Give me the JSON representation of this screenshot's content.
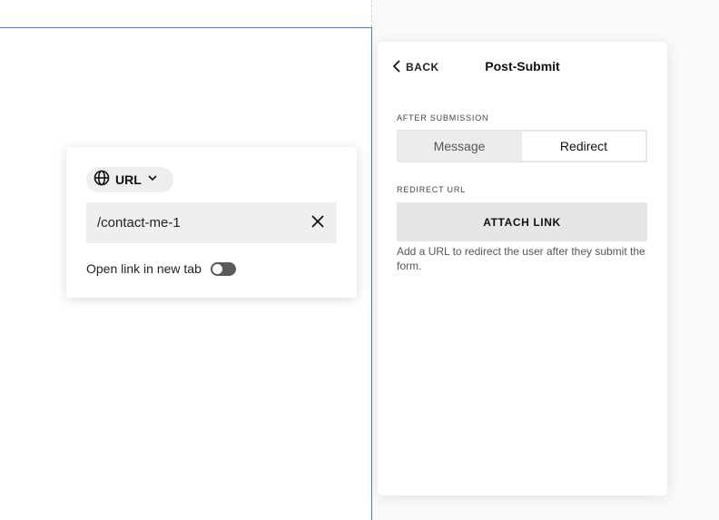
{
  "popover": {
    "url_type_label": "URL",
    "url_value": "/contact-me-1",
    "new_tab_label": "Open link in new tab",
    "new_tab_enabled": false
  },
  "panel": {
    "back_label": "BACK",
    "title": "Post-Submit",
    "after_submission_label": "AFTER SUBMISSION",
    "options": [
      "Message",
      "Redirect"
    ],
    "selected_option": "Redirect",
    "redirect_url_label": "REDIRECT URL",
    "attach_link_label": "ATTACH LINK",
    "help_text": "Add a URL to redirect the user after they submit the form."
  },
  "colors": {
    "selection_border": "#3b78d4",
    "toggle_off": "#5a5a5a"
  }
}
